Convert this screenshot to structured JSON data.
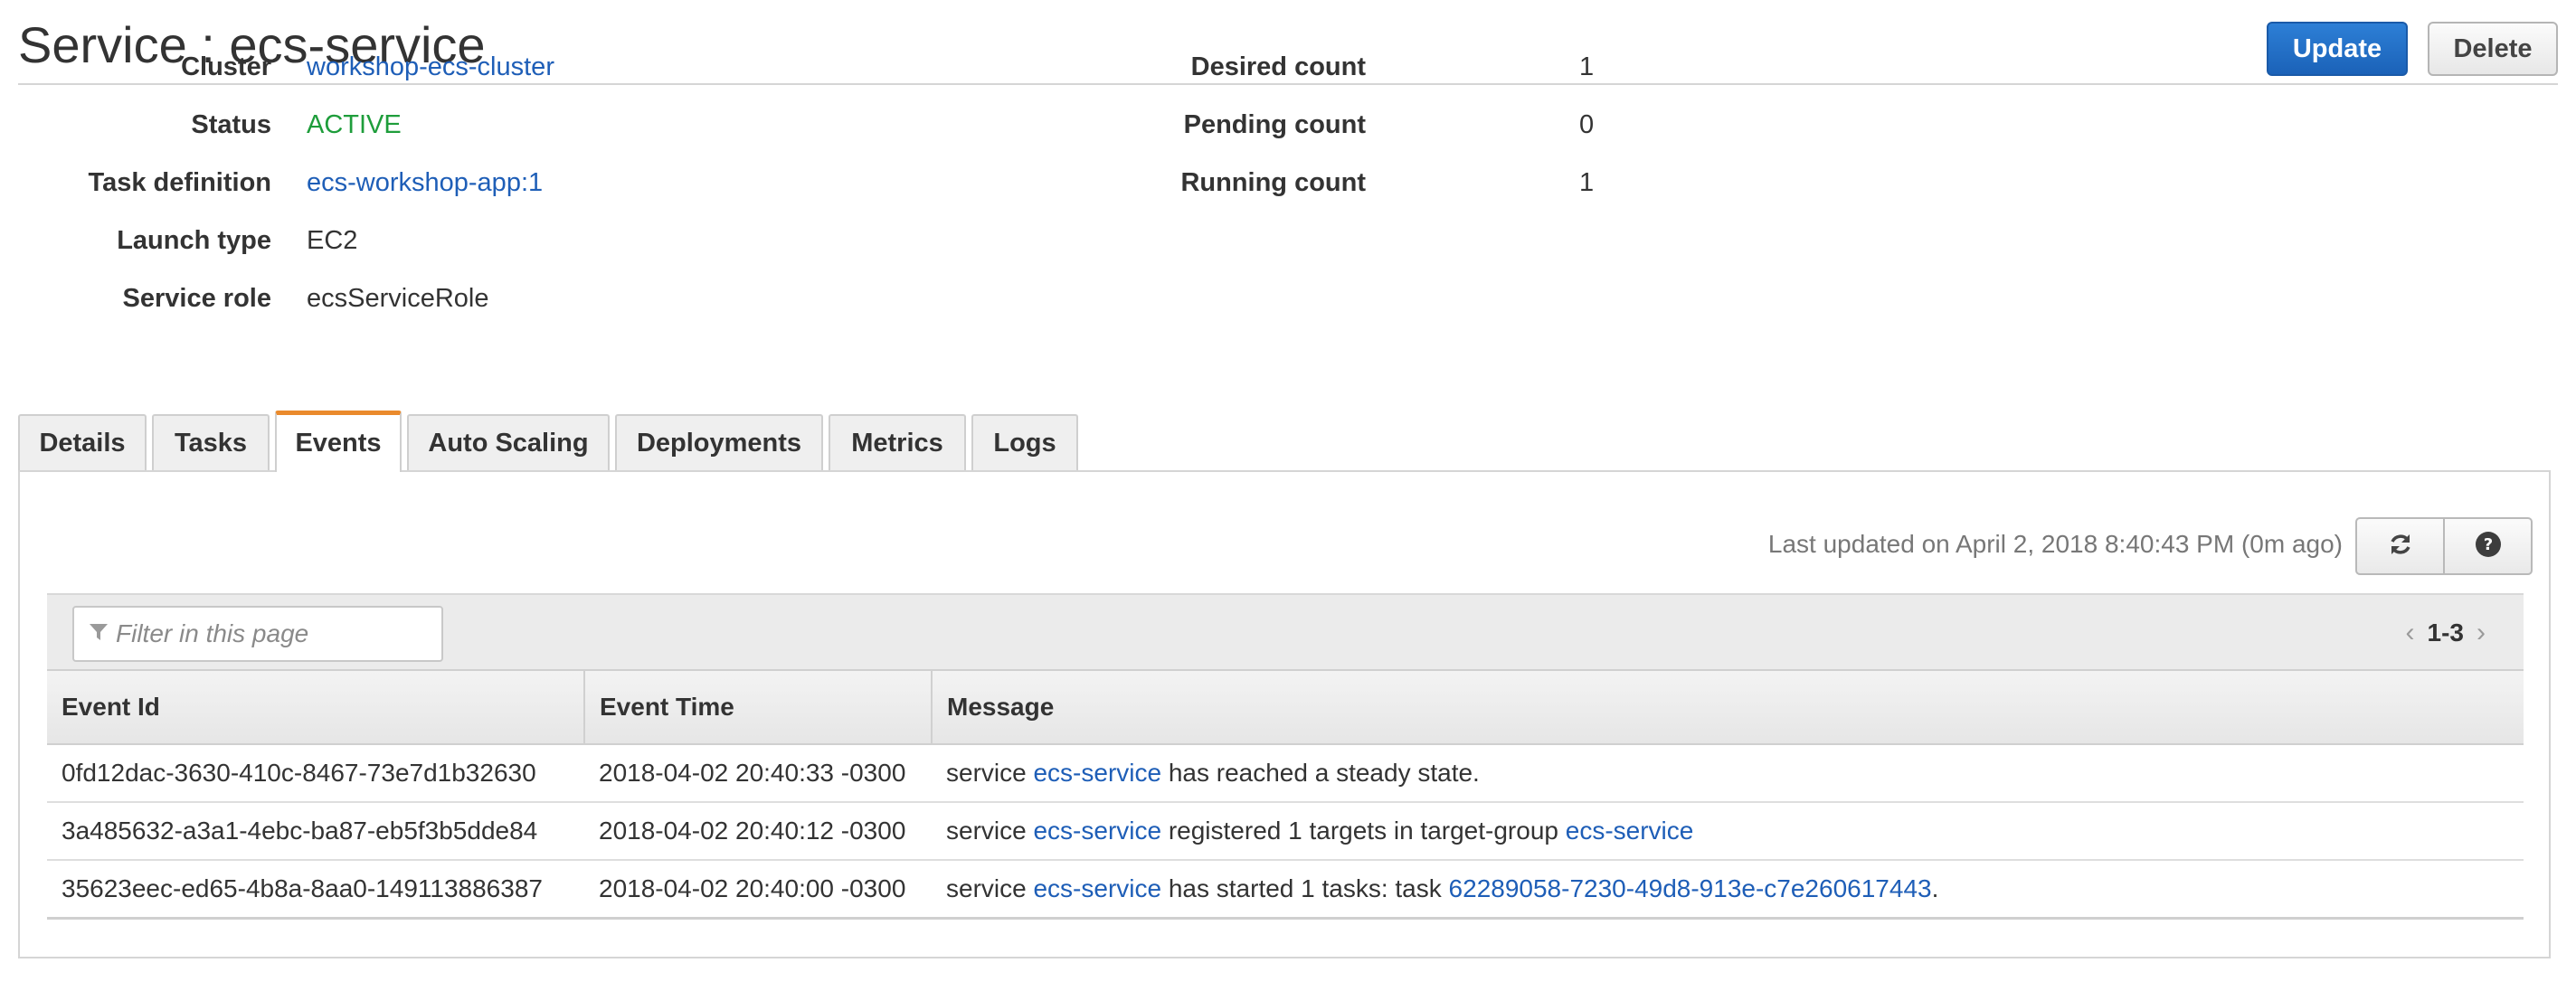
{
  "page": {
    "title": "Service : ecs-service",
    "update_label": "Update",
    "delete_label": "Delete"
  },
  "summary": {
    "left": [
      {
        "label": "Cluster",
        "value": "workshop-ecs-cluster"
      },
      {
        "label": "Status",
        "value": "ACTIVE"
      },
      {
        "label": "Task definition",
        "value": "ecs-workshop-app:1"
      },
      {
        "label": "Launch type",
        "value": "EC2"
      },
      {
        "label": "Service role",
        "value": "ecsServiceRole"
      }
    ],
    "right": [
      {
        "label": "Desired count",
        "value": "1"
      },
      {
        "label": "Pending count",
        "value": "0"
      },
      {
        "label": "Running count",
        "value": "1"
      }
    ]
  },
  "tabs": [
    {
      "label": "Details"
    },
    {
      "label": "Tasks"
    },
    {
      "label": "Events",
      "active": true
    },
    {
      "label": "Auto Scaling"
    },
    {
      "label": "Deployments"
    },
    {
      "label": "Metrics"
    },
    {
      "label": "Logs"
    }
  ],
  "events": {
    "last_updated": "Last updated on April 2, 2018 8:40:43 PM (0m ago)",
    "filter_placeholder": "Filter in this page",
    "pager_range": "1-3",
    "columns": [
      "Event Id",
      "Event Time",
      "Message"
    ],
    "rows": [
      {
        "id": "0fd12dac-3630-410c-8467-73e7d1b32630",
        "time": "2018-04-02 20:40:33 -0300",
        "message": {
          "pre": "service ",
          "link1": "ecs-service",
          "mid": " has reached a steady state.",
          "link2": "",
          "post": ""
        }
      },
      {
        "id": "3a485632-a3a1-4ebc-ba87-eb5f3b5dde84",
        "time": "2018-04-02 20:40:12 -0300",
        "message": {
          "pre": "service ",
          "link1": "ecs-service",
          "mid": " registered 1 targets in target-group ",
          "link2": "ecs-service",
          "post": ""
        }
      },
      {
        "id": "35623eec-ed65-4b8a-8aa0-149113886387",
        "time": "2018-04-02 20:40:00 -0300",
        "message": {
          "pre": "service ",
          "link1": "ecs-service",
          "mid": " has started 1 tasks: task ",
          "link2": "62289058-7230-49d8-913e-c7e260617443",
          "post": "."
        }
      }
    ]
  },
  "colors": {
    "link": "#1e5eb7",
    "active_status": "#1e9d3b",
    "primary_button": "#1b62b8",
    "active_tab_accent": "#ea8a2c"
  },
  "icons": {
    "refresh": "refresh-icon",
    "help": "help-icon",
    "filter": "filter-icon",
    "prev": "chevron-left-icon",
    "next": "chevron-right-icon"
  }
}
